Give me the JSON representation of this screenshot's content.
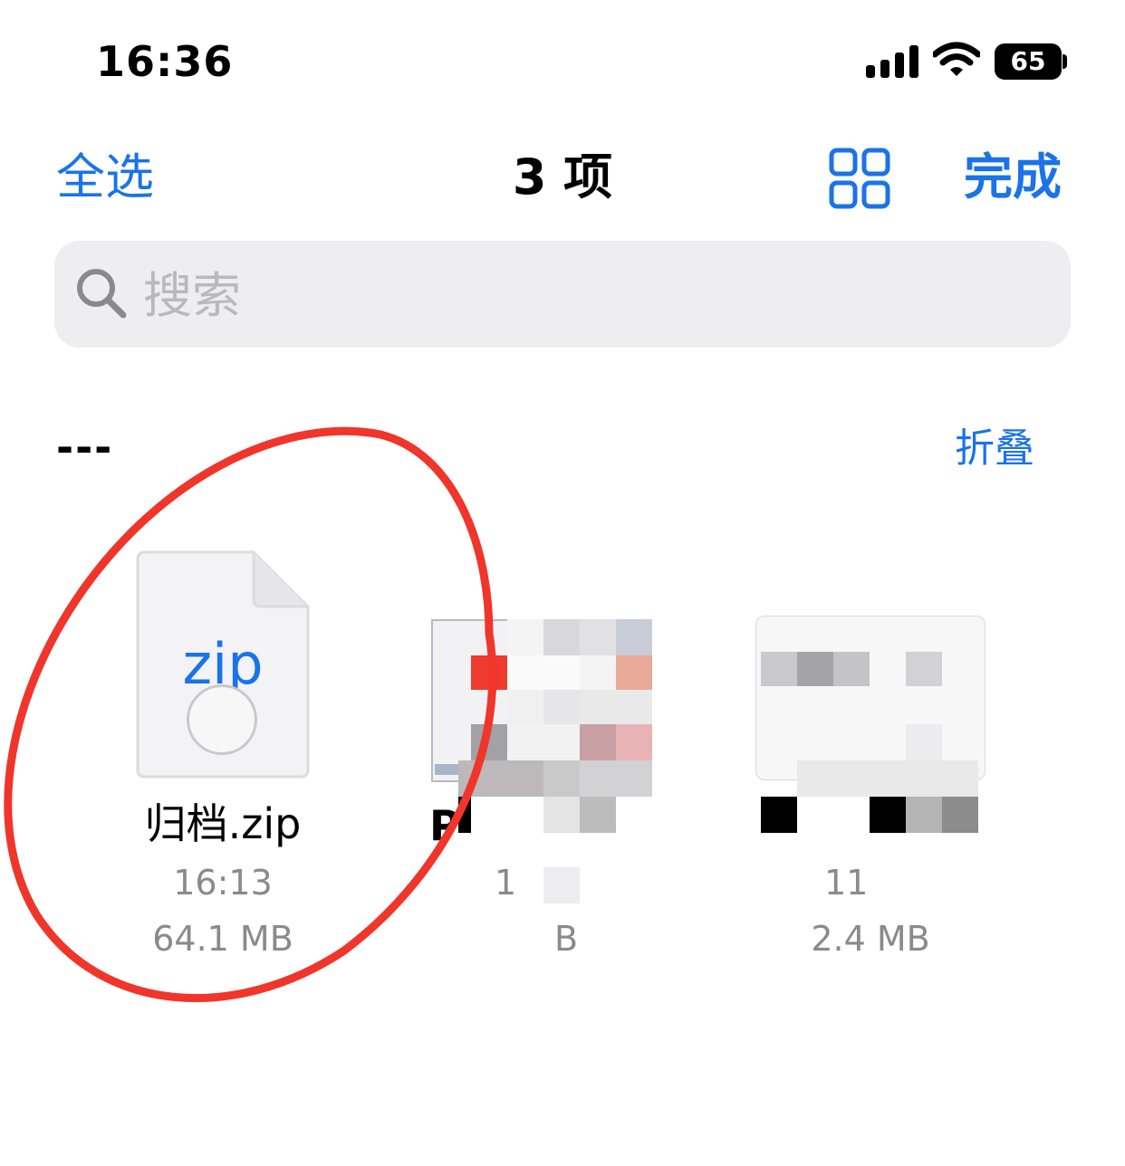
{
  "status_bar": {
    "time": "16:36",
    "battery": "65"
  },
  "nav": {
    "select_all": "全选",
    "title": "3 项",
    "done": "完成",
    "view_icon": "grid-view-icon"
  },
  "search": {
    "placeholder": "搜索",
    "icon": "magnifier-icon"
  },
  "section": {
    "title": "---",
    "collapse": "折叠"
  },
  "files": [
    {
      "name": "归档.zip",
      "time": "16:13",
      "size": "64.1 MB",
      "badge": "zip",
      "icon": "zip-file-icon"
    },
    {
      "name": "P",
      "time": "1",
      "size": "B",
      "icon": "document-thumbnail"
    },
    {
      "name": "",
      "time": "11",
      "size": "2.4 MB",
      "icon": "document-thumbnail"
    }
  ],
  "colors": {
    "accent": "#1a73e8",
    "annotation": "#f0352b"
  }
}
